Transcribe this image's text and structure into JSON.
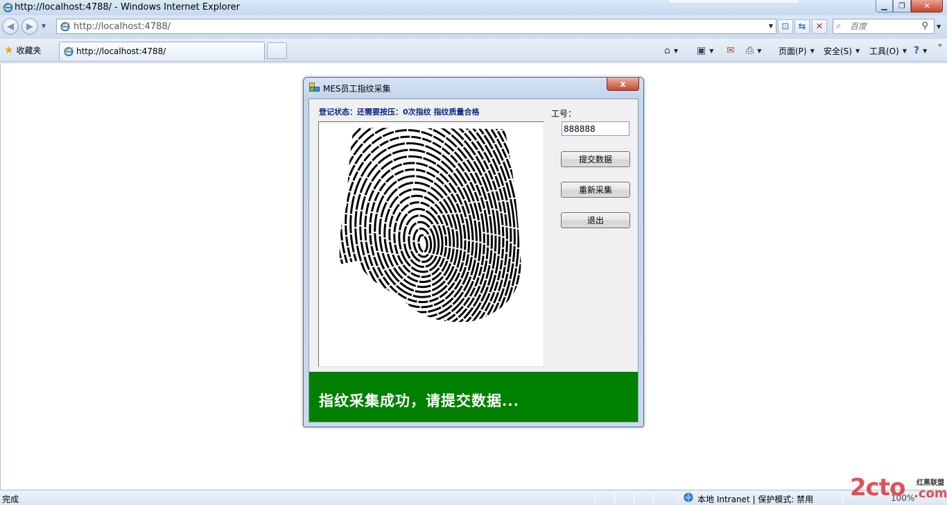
{
  "window": {
    "title": "http://localhost:4788/ - Windows Internet Explorer"
  },
  "address_bar": {
    "url": "http://localhost:4788/"
  },
  "search": {
    "placeholder": "百度"
  },
  "favorites": {
    "label": "收藏夹"
  },
  "tab": {
    "label": "http://localhost:4788/"
  },
  "command_bar": {
    "page_label": "页面(P)",
    "safety_label": "安全(S)",
    "tools_label": "工具(O)"
  },
  "dialog": {
    "title": "MES员工指纹采集",
    "close_glyph": "x",
    "registration_status": "登记状态：还需要按压：0次指纹 指纹质量合格",
    "employee_id_label": "工号：",
    "employee_id_value": "888888",
    "submit_label": "提交数据",
    "recapture_label": "重新采集",
    "exit_label": "退出",
    "success_message": "指纹采集成功，请提交数据...",
    "banner_color": "#008000",
    "status_color": "#0a2a8c"
  },
  "statusbar": {
    "left_text": "完成",
    "zone_text": "本地 Intranet | 保护模式: 禁用",
    "zoom_text": "100%"
  },
  "watermark": {
    "main": "2cto",
    "side": "红黑联盟",
    "com": ".com"
  }
}
